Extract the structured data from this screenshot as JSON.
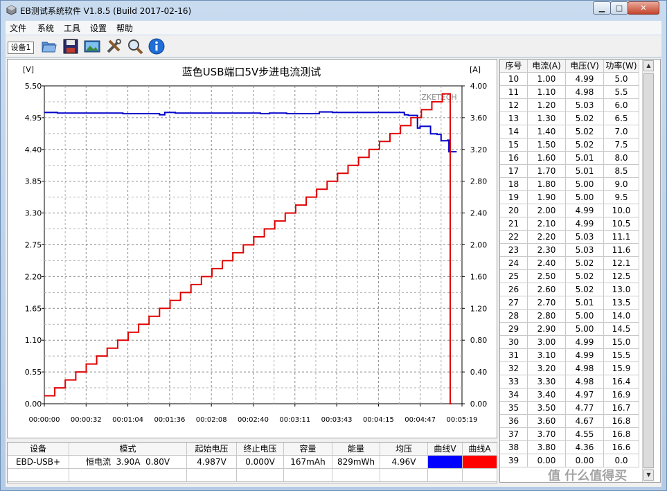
{
  "window": {
    "title": "EB测试系统软件 V1.8.5 (Build 2017-02-16)",
    "controls": [
      "0",
      "□",
      "X"
    ]
  },
  "menu": [
    "文件",
    "系统",
    "工具",
    "设置",
    "帮助"
  ],
  "toolbar": {
    "device_tab": "设备1",
    "icons": [
      "folder-open-icon",
      "save-icon",
      "picture-icon",
      "tools-icon",
      "magnifier-icon",
      "info-icon"
    ]
  },
  "chart_data": {
    "type": "line",
    "title": "蓝色USB端口5V步进电流测试",
    "watermark": "ZKETECH",
    "ylabel_left": "[V]",
    "ylabel_right": "[A]",
    "ylim_left": [
      0,
      5.5
    ],
    "ylim_right": [
      0,
      4.0
    ],
    "yticks_left": [
      "5.50",
      "4.95",
      "4.40",
      "3.85",
      "3.30",
      "2.75",
      "2.20",
      "1.65",
      "1.10",
      "0.55",
      "0.00"
    ],
    "yticks_right": [
      "4.00",
      "3.60",
      "3.20",
      "2.80",
      "2.40",
      "2.00",
      "1.60",
      "1.20",
      "0.80",
      "0.40",
      "0.00"
    ],
    "xticks": [
      "00:00:00",
      "00:00:32",
      "00:01:04",
      "00:01:36",
      "00:02:08",
      "00:02:40",
      "00:03:11",
      "00:03:43",
      "00:04:15",
      "00:04:47",
      "00:05:19"
    ],
    "xlim_seconds": [
      0,
      319
    ],
    "grid": true,
    "series": [
      {
        "axis": "left",
        "color": "#0000cc",
        "x_seconds": [
          0,
          10,
          60,
          88,
          92,
          100,
          165,
          172,
          185,
          210,
          220,
          275,
          278,
          285,
          287,
          295,
          300,
          303,
          308,
          309,
          315
        ],
        "y": [
          5.04,
          5.03,
          5.02,
          5.0,
          5.04,
          5.03,
          5.02,
          5.03,
          5.02,
          5.05,
          5.04,
          5.0,
          4.99,
          4.77,
          4.8,
          4.67,
          4.66,
          4.55,
          4.56,
          4.36,
          4.36
        ]
      },
      {
        "axis": "right",
        "color": "#e00000",
        "x_seconds": [
          0,
          8,
          16,
          24,
          32,
          40,
          48,
          56,
          64,
          72,
          80,
          88,
          96,
          104,
          112,
          120,
          128,
          136,
          144,
          152,
          160,
          168,
          176,
          184,
          192,
          200,
          208,
          216,
          224,
          232,
          240,
          248,
          256,
          264,
          272,
          280,
          288,
          296,
          304,
          309,
          310,
          311
        ],
        "y": [
          0.1,
          0.2,
          0.3,
          0.4,
          0.5,
          0.6,
          0.7,
          0.8,
          0.9,
          1.0,
          1.1,
          1.2,
          1.3,
          1.4,
          1.5,
          1.6,
          1.7,
          1.8,
          1.9,
          2.0,
          2.1,
          2.2,
          2.3,
          2.4,
          2.5,
          2.6,
          2.7,
          2.8,
          2.9,
          3.0,
          3.1,
          3.2,
          3.3,
          3.4,
          3.5,
          3.6,
          3.7,
          3.8,
          3.9,
          3.9,
          0.0,
          0.0
        ]
      }
    ]
  },
  "table": {
    "headers": [
      "序号",
      "电流(A)",
      "电压(V)",
      "功率(W)"
    ],
    "rows": [
      [
        "10",
        "1.00",
        "4.99",
        "5.0"
      ],
      [
        "11",
        "1.10",
        "4.98",
        "5.5"
      ],
      [
        "12",
        "1.20",
        "5.03",
        "6.0"
      ],
      [
        "13",
        "1.30",
        "5.02",
        "6.5"
      ],
      [
        "14",
        "1.40",
        "5.02",
        "7.0"
      ],
      [
        "15",
        "1.50",
        "5.02",
        "7.5"
      ],
      [
        "16",
        "1.60",
        "5.01",
        "8.0"
      ],
      [
        "17",
        "1.70",
        "5.01",
        "8.5"
      ],
      [
        "18",
        "1.80",
        "5.00",
        "9.0"
      ],
      [
        "19",
        "1.90",
        "5.00",
        "9.5"
      ],
      [
        "20",
        "2.00",
        "4.99",
        "10.0"
      ],
      [
        "21",
        "2.10",
        "4.99",
        "10.5"
      ],
      [
        "22",
        "2.20",
        "5.03",
        "11.1"
      ],
      [
        "23",
        "2.30",
        "5.03",
        "11.6"
      ],
      [
        "24",
        "2.40",
        "5.02",
        "12.1"
      ],
      [
        "25",
        "2.50",
        "5.02",
        "12.5"
      ],
      [
        "26",
        "2.60",
        "5.02",
        "13.0"
      ],
      [
        "27",
        "2.70",
        "5.01",
        "13.5"
      ],
      [
        "28",
        "2.80",
        "5.00",
        "14.0"
      ],
      [
        "29",
        "2.90",
        "5.00",
        "14.5"
      ],
      [
        "30",
        "3.00",
        "4.99",
        "15.0"
      ],
      [
        "31",
        "3.10",
        "4.99",
        "15.5"
      ],
      [
        "32",
        "3.20",
        "4.98",
        "15.9"
      ],
      [
        "33",
        "3.30",
        "4.98",
        "16.4"
      ],
      [
        "34",
        "3.40",
        "4.97",
        "16.9"
      ],
      [
        "35",
        "3.50",
        "4.77",
        "16.7"
      ],
      [
        "36",
        "3.60",
        "4.67",
        "16.8"
      ],
      [
        "37",
        "3.70",
        "4.55",
        "16.8"
      ],
      [
        "38",
        "3.80",
        "4.36",
        "16.6"
      ],
      [
        "39",
        "0.00",
        "0.00",
        "0.0"
      ]
    ]
  },
  "summary": {
    "headers": [
      "设备",
      "模式",
      "起始电压",
      "终止电压",
      "容量",
      "能量",
      "均压",
      "曲线V",
      "曲线A"
    ],
    "values": [
      "EBD-USB+",
      "恒电流  3.90A  0.80V",
      "4.987V",
      "0.000V",
      "167mAh",
      "829mWh",
      "4.96V"
    ],
    "curve_v_color": "#0000ff",
    "curve_a_color": "#ff0000"
  },
  "overlay_watermark": "值  什么值得买"
}
